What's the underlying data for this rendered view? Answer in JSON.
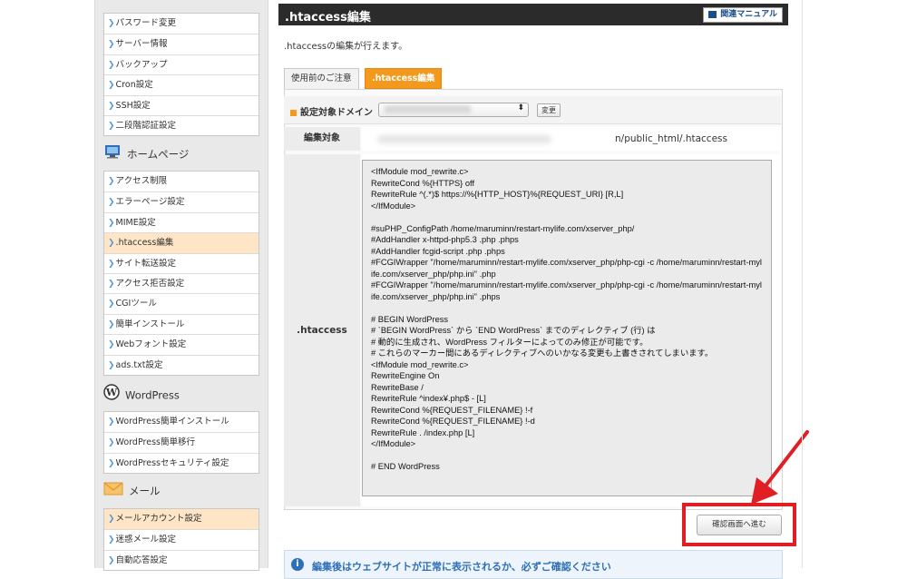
{
  "sidebar": {
    "group1": [
      "パスワード変更",
      "サーバー情報",
      "バックアップ",
      "Cron設定",
      "SSH設定",
      "二段階認証設定"
    ],
    "homepage_title": "ホームページ",
    "group2": [
      "アクセス制限",
      "エラーページ設定",
      "MIME設定",
      ".htaccess編集",
      "サイト転送設定",
      "アクセス拒否設定",
      "CGIツール",
      "簡単インストール",
      "Webフォント設定",
      "ads.txt設定"
    ],
    "wordpress_title": "WordPress",
    "group3": [
      "WordPress簡単インストール",
      "WordPress簡単移行",
      "WordPressセキュリティ設定"
    ],
    "mail_title": "メール",
    "group4": [
      "メールアカウント設定",
      "迷惑メール設定",
      "自動応答設定"
    ]
  },
  "header": {
    "title": ".htaccess編集",
    "manual_label": "関連マニュアル"
  },
  "intro": ".htaccessの編集が行えます。",
  "tabs": [
    {
      "label": "使用前のご注意"
    },
    {
      "label": ".htaccess編集"
    }
  ],
  "form": {
    "domain_label": "設定対象ドメイン",
    "change_label": "変更",
    "target_label": "編集対象",
    "target_path": "n/public_html/.htaccess",
    "htaccess_label": ".htaccess",
    "htaccess_content": "<IfModule mod_rewrite.c>\nRewriteCond %{HTTPS} off\nRewriteRule ^(.*)$ https://%{HTTP_HOST}%{REQUEST_URI} [R,L]\n</IfModule>\n\n#suPHP_ConfigPath /home/maruminn/restart-mylife.com/xserver_php/\n#AddHandler x-httpd-php5.3 .php .phps\n#AddHandler fcgid-script .php .phps\n#FCGIWrapper \"/home/maruminn/restart-mylife.com/xserver_php/php-cgi -c /home/maruminn/restart-mylife.com/xserver_php/php.ini\" .php\n#FCGIWrapper \"/home/maruminn/restart-mylife.com/xserver_php/php-cgi -c /home/maruminn/restart-mylife.com/xserver_php/php.ini\" .phps\n\n# BEGIN WordPress\n# `BEGIN WordPress` から `END WordPress` までのディレクティブ (行) は\n# 動的に生成され、WordPress フィルターによってのみ修正が可能です。\n# これらのマーカー間にあるディレクティブへのいかなる変更も上書きされてしまいます。\n<IfModule mod_rewrite.c>\nRewriteEngine On\nRewriteBase /\nRewriteRule ^index¥.php$ - [L]\nRewriteCond %{REQUEST_FILENAME} !-f\nRewriteCond %{REQUEST_FILENAME} !-d\nRewriteRule . /index.php [L]\n</IfModule>\n\n# END WordPress",
    "confirm_label": "確認画面へ進む"
  },
  "notice": "編集後はウェブサイトが正常に表示されるか、必ずご確認ください",
  "colors": {
    "accent": "#f39a1e",
    "highlight": "#e01e24",
    "title_bg": "#2b2b2b"
  }
}
